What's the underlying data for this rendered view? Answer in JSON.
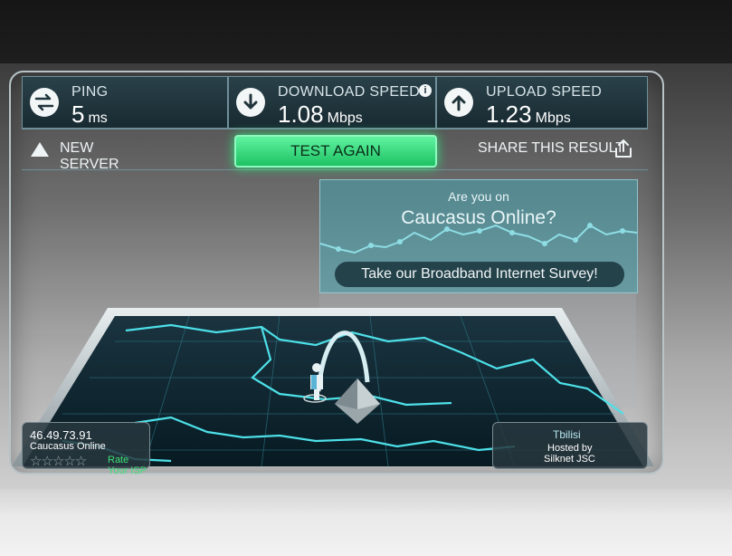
{
  "stats": {
    "ping": {
      "label": "PING",
      "value": "5",
      "unit": "ms"
    },
    "download": {
      "label": "DOWNLOAD SPEED",
      "value": "1.08",
      "unit": "Mbps"
    },
    "upload": {
      "label": "UPLOAD SPEED",
      "value": "1.23",
      "unit": "Mbps"
    }
  },
  "actions": {
    "new_server": "NEW SERVER",
    "test_again": "TEST AGAIN",
    "share": "SHARE THIS RESULT"
  },
  "survey": {
    "question_line1": "Are you on",
    "question_line2": "Caucasus Online?",
    "cta": "Take our Broadband Internet Survey!"
  },
  "isp": {
    "ip": "46.49.73.91",
    "name": "Caucasus Online",
    "rating_label": "Rate Your ISP",
    "stars": "☆☆☆☆☆"
  },
  "server": {
    "city": "Tbilisi",
    "hosted_by_label": "Hosted by",
    "host": "Silknet JSC"
  },
  "colors": {
    "accent_green": "#31e27a",
    "panel": "#1f343b"
  },
  "icons": [
    "ping-arrows-icon",
    "download-arrow-icon",
    "info-icon",
    "upload-arrow-icon",
    "triangle-icon",
    "share-icon",
    "person-marker-icon",
    "server-pyramid-icon"
  ]
}
